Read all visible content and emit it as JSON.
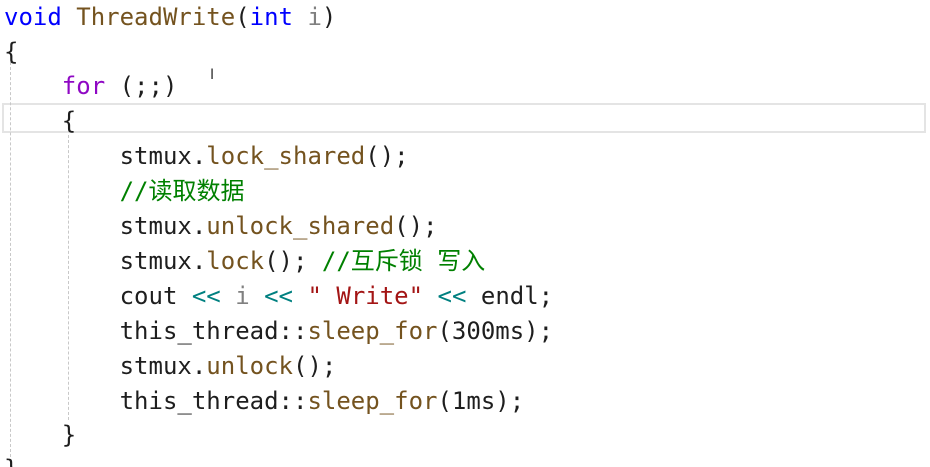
{
  "editor": {
    "lines": [
      [
        {
          "cls": "tok-kw",
          "text": "void "
        },
        {
          "cls": "tok-fn",
          "text": "ThreadWrite"
        },
        {
          "cls": "tok-punct",
          "text": "("
        },
        {
          "cls": "tok-kw",
          "text": "int "
        },
        {
          "cls": "tok-param",
          "text": "i"
        },
        {
          "cls": "tok-punct",
          "text": ")"
        }
      ],
      [
        {
          "cls": "tok-punct",
          "text": "{"
        }
      ],
      [
        {
          "cls": "tok-plain",
          "text": "    "
        },
        {
          "cls": "tok-ctrl",
          "text": "for"
        },
        {
          "cls": "tok-punct",
          "text": " (;;)"
        }
      ],
      [
        {
          "cls": "tok-plain",
          "text": "    "
        },
        {
          "cls": "tok-punct",
          "text": "{"
        }
      ],
      [
        {
          "cls": "tok-plain",
          "text": "        stmux."
        },
        {
          "cls": "tok-fn",
          "text": "lock_shared"
        },
        {
          "cls": "tok-punct",
          "text": "();"
        }
      ],
      [
        {
          "cls": "tok-plain",
          "text": "        "
        },
        {
          "cls": "tok-cm",
          "text": "//读取数据"
        }
      ],
      [
        {
          "cls": "tok-plain",
          "text": "        stmux."
        },
        {
          "cls": "tok-fn",
          "text": "unlock_shared"
        },
        {
          "cls": "tok-punct",
          "text": "();"
        }
      ],
      [
        {
          "cls": "tok-plain",
          "text": "        stmux."
        },
        {
          "cls": "tok-fn",
          "text": "lock"
        },
        {
          "cls": "tok-punct",
          "text": "(); "
        },
        {
          "cls": "tok-cm",
          "text": "//互斥锁 写入"
        }
      ],
      [
        {
          "cls": "tok-plain",
          "text": "        cout "
        },
        {
          "cls": "tok-op",
          "text": "<<"
        },
        {
          "cls": "tok-param",
          "text": " i "
        },
        {
          "cls": "tok-op",
          "text": "<<"
        },
        {
          "cls": "tok-str",
          "text": " \" Write\" "
        },
        {
          "cls": "tok-op",
          "text": "<<"
        },
        {
          "cls": "tok-plain",
          "text": " endl;"
        }
      ],
      [
        {
          "cls": "tok-plain",
          "text": "        this_thread::"
        },
        {
          "cls": "tok-fn",
          "text": "sleep_for"
        },
        {
          "cls": "tok-punct",
          "text": "(300ms);"
        }
      ],
      [
        {
          "cls": "tok-plain",
          "text": "        stmux."
        },
        {
          "cls": "tok-fn",
          "text": "unlock"
        },
        {
          "cls": "tok-punct",
          "text": "();"
        }
      ],
      [
        {
          "cls": "tok-plain",
          "text": "        this_thread::"
        },
        {
          "cls": "tok-fn",
          "text": "sleep_for"
        },
        {
          "cls": "tok-punct",
          "text": "(1ms);"
        }
      ],
      [
        {
          "cls": "tok-plain",
          "text": "    "
        },
        {
          "cls": "tok-punct",
          "text": "}"
        }
      ],
      [
        {
          "cls": "tok-punct",
          "text": "}"
        }
      ]
    ],
    "cursor_glyph": "I",
    "current_line_index": 3
  },
  "colors": {
    "keyword": "#0000ff",
    "control": "#8f08c4",
    "function": "#74531f",
    "parameter": "#808080",
    "comment": "#008000",
    "string": "#a31515",
    "operator": "#008080",
    "text": "#1e1e1e"
  }
}
